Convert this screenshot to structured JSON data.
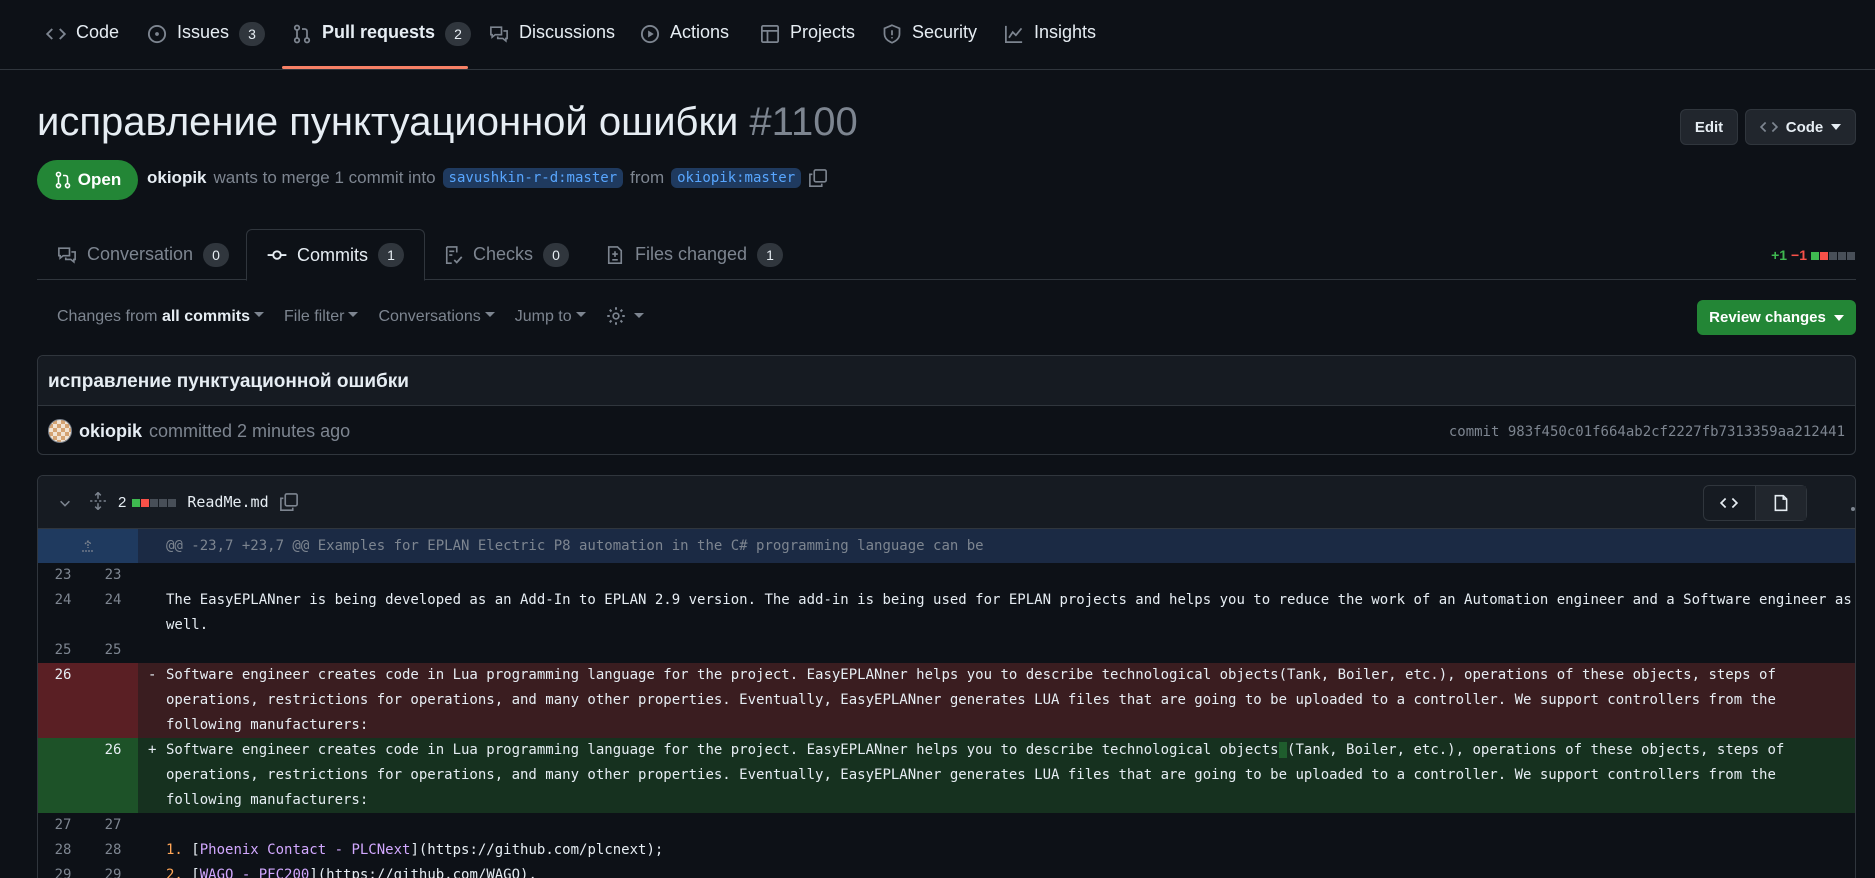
{
  "repo_nav": {
    "code": "Code",
    "issues": "Issues",
    "issues_count": "3",
    "pulls": "Pull requests",
    "pulls_count": "2",
    "discussions": "Discussions",
    "actions": "Actions",
    "projects": "Projects",
    "security": "Security",
    "insights": "Insights"
  },
  "pr": {
    "title": "исправление пунктуационной ошибки",
    "number": "#1100",
    "edit_label": "Edit",
    "code_label": "Code",
    "state": "Open",
    "author": "okiopik",
    "merge_text": "wants to merge 1 commit into",
    "base_branch": "savushkin-r-d:master",
    "from_text": "from",
    "head_branch": "okiopik:master"
  },
  "tabs": [
    {
      "label": "Conversation",
      "count": "0"
    },
    {
      "label": "Commits",
      "count": "1"
    },
    {
      "label": "Checks",
      "count": "0"
    },
    {
      "label": "Files changed",
      "count": "1"
    }
  ],
  "diffstat": {
    "additions": "+1",
    "deletions": "−1"
  },
  "toolbar": {
    "changes_from": "Changes from",
    "changes_value": "all commits",
    "file_filter": "File filter",
    "conversations": "Conversations",
    "jump_to": "Jump to",
    "review_changes": "Review changes"
  },
  "commit": {
    "message": "исправление пунктуационной ошибки",
    "author": "okiopik",
    "action": "committed 2 minutes ago",
    "sha": "commit 983f450c01f664ab2cf2227fb7313359aa212441"
  },
  "file": {
    "changes": "2",
    "name": "ReadMe.md"
  },
  "diff": {
    "hunk": "@@ -23,7 +23,7 @@ Examples for EPLAN Electric P8 automation in the C# programming language can be",
    "lines": [
      {
        "old": "23",
        "new": "23",
        "text": ""
      },
      {
        "old": "24",
        "new": "24",
        "text": "The EasyEPLANner is being developed as an Add-In to EPLAN 2.9 version. The add-in is being used for EPLAN projects and helps you to reduce the work of an Automation engineer and a Software engineer as well."
      },
      {
        "old": "25",
        "new": "25",
        "text": ""
      },
      {
        "old": "26",
        "new": "",
        "sign": "-",
        "text": "Software engineer creates code in Lua programming language for the project. EasyEPLANner helps you to describe technological objects(Tank, Boiler, etc.), operations of these objects, steps of operations, restrictions for operations, and many other properties. Eventually, EasyEPLANner generates LUA files that are going to be uploaded to a controller. We support controllers from the following manufacturers:"
      },
      {
        "old": "",
        "new": "26",
        "sign": "+",
        "text_before": "Software engineer creates code in Lua programming language for the project. EasyEPLANner helps you to describe technological objects",
        "text_highlight": " ",
        "text_after": "(Tank, Boiler, etc.), operations of these objects, steps of operations, restrictions for operations, and many other properties. Eventually, EasyEPLANner generates LUA files that are going to be uploaded to a controller. We support controllers from the following manufacturers:"
      },
      {
        "old": "27",
        "new": "27",
        "text": ""
      },
      {
        "old": "28",
        "new": "28",
        "num": "1.",
        "lb": "[",
        "link": "Phoenix Contact - PLCNext",
        "rest": "](https://github.com/plcnext);"
      },
      {
        "old": "29",
        "new": "29",
        "num": "2.",
        "lb": "[",
        "link": "WAGO - PFC200",
        "rest": "](https://github.com/WAGO)."
      }
    ]
  },
  "colors": {
    "accent": "#f78166",
    "open": "#238636",
    "link": "#58a6ff"
  }
}
